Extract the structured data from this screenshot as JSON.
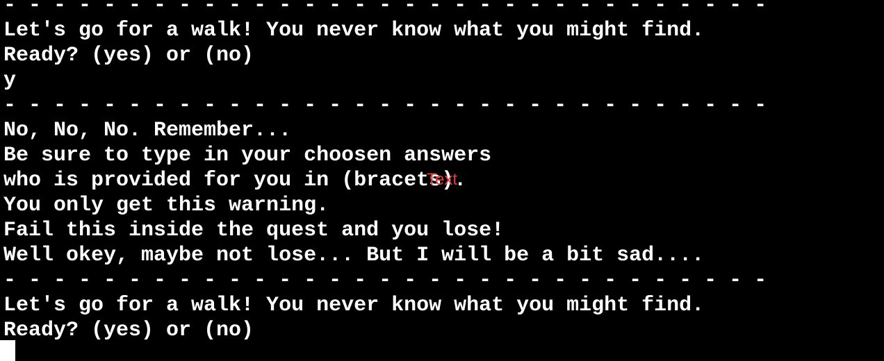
{
  "terminal": {
    "lines": [
      "- - - - - - - - - - - - - - - - - - - - - - - - - - - - - - -",
      "Let's go for a walk! You never know what you might find.",
      "Ready? (yes) or (no)",
      "y",
      "- - - - - - - - - - - - - - - - - - - - - - - - - - - - - - -",
      "No, No, No. Remember...",
      "Be sure to type in your choosen answers",
      "who is provided for you in (bracets).",
      "You only get this warning.",
      "Fail this inside the quest and you lose!",
      "Well okey, maybe not lose... But I will be a bit sad....",
      "- - - - - - - - - - - - - - - - - - - - - - - - - - - - - - -",
      "Let's go for a walk! You never know what you might find.",
      "Ready? (yes) or (no)"
    ]
  },
  "overlay": {
    "text": "Text",
    "color": "#e23d3d"
  }
}
